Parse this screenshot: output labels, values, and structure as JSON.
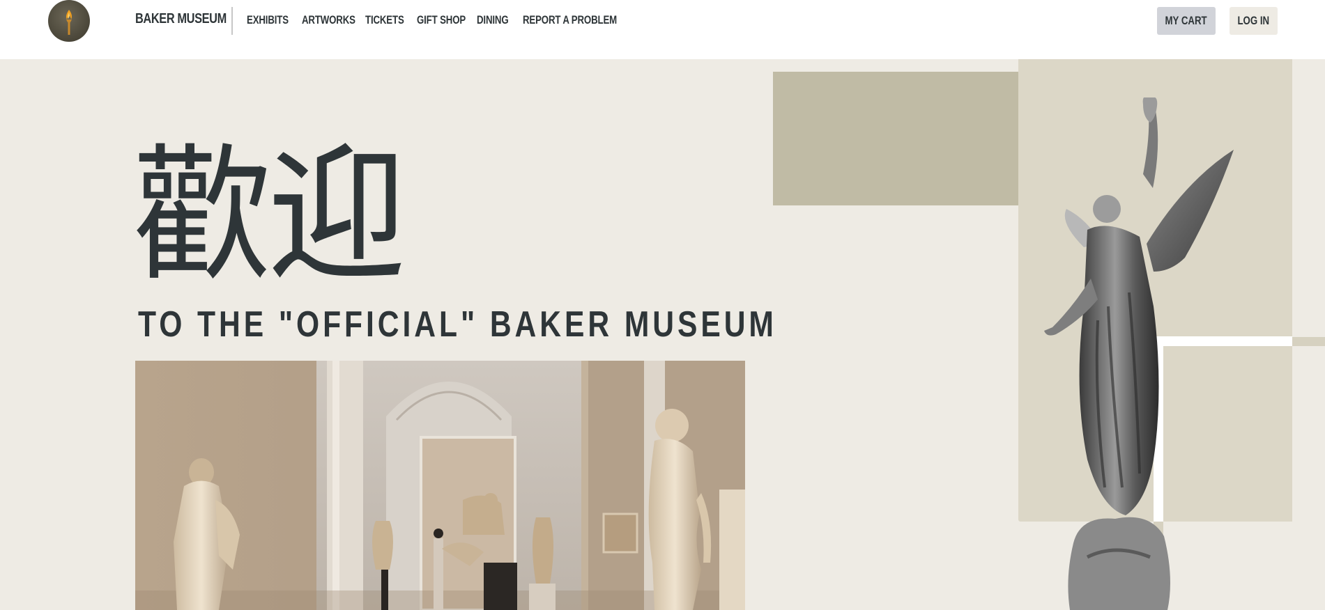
{
  "header": {
    "brand": "BAKER MUSEUM",
    "nav": [
      {
        "label": "EXHIBITS"
      },
      {
        "label": "ARTWORKS"
      },
      {
        "label": "TICKETS"
      },
      {
        "label": "GIFT SHOP"
      },
      {
        "label": "DINING"
      },
      {
        "label": "REPORT A PROBLEM"
      }
    ],
    "cart_label": "MY CART",
    "login_label": "LOG IN",
    "logo_icon": "torch-icon"
  },
  "hero": {
    "title": "歡迎",
    "subtitle": "TO THE \"OFFICIAL\" BAKER MUSEUM"
  },
  "colors": {
    "background": "#eeebe4",
    "text": "#2e3538",
    "cart_button": "#d1d3d9",
    "accent_block": "#c0bba5",
    "panel": "#dcd7c7"
  }
}
